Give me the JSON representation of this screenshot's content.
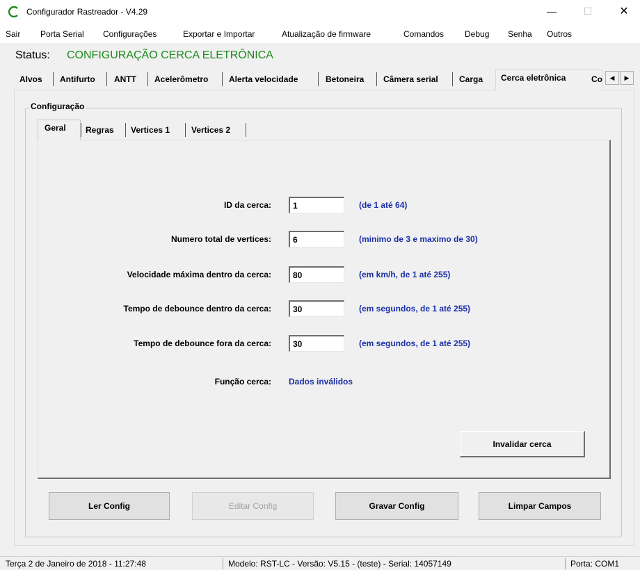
{
  "window": {
    "title": "Configurador Rastreador - V4.29",
    "controls": {
      "minimize": "—",
      "maximize": "☐",
      "close": "✕"
    }
  },
  "menu": [
    "Sair",
    "Porta Serial",
    "Configurações",
    "Exportar e Importar",
    "Atualização de firmware",
    "Comandos",
    "Debug",
    "Senha",
    "Outros"
  ],
  "status": {
    "label": "Status:",
    "value": "CONFIGURAÇÃO CERCA ELETRÔNICA"
  },
  "outer_tabs": [
    "Alvos",
    "Antifurto",
    "ANTT",
    "Acelerômetro",
    "Alerta velocidade",
    "Betoneira",
    "Câmera serial",
    "Carga",
    "Cerca eletrônica",
    "Co"
  ],
  "outer_tab_active": "Cerca eletrônica",
  "scroll_arrows": {
    "left": "◀",
    "right": "▶"
  },
  "group": {
    "title": "Configuração"
  },
  "inner_tabs": [
    "Geral",
    "Regras",
    "Vertices 1",
    "Vertices 2"
  ],
  "inner_tab_active": "Geral",
  "form": {
    "fields": [
      {
        "label": "ID da cerca:",
        "value": "1",
        "hint": "(de 1 até 64)"
      },
      {
        "label": "Numero total de vertices:",
        "value": "6",
        "hint": "(minimo de 3 e maximo de 30)"
      },
      {
        "label": "Velocidade máxima dentro da cerca:",
        "value": "80",
        "hint": "(em km/h, de 1 até 255)"
      },
      {
        "label": "Tempo de debounce dentro da cerca:",
        "value": "30",
        "hint": "(em segundos, de 1 até 255)"
      },
      {
        "label": "Tempo de debounce fora da cerca:",
        "value": "30",
        "hint": "(em segundos, de 1 até 255)"
      }
    ],
    "function_label": "Função cerca:",
    "function_value": "Dados inválidos",
    "invalidate_button": "Invalidar cerca"
  },
  "actions": {
    "read": "Ler Config",
    "edit": "Editar Config",
    "write": "Gravar Config",
    "clear": "Limpar Campos"
  },
  "statusbar": {
    "datetime": "Terça 2 de Janeiro de 2018  -  11:27:48",
    "device": "Modelo: RST-LC  -  Versão: V5.15 - (teste)  -  Serial: 14057149",
    "port": "Porta: COM1"
  },
  "colors": {
    "status_green": "#1b8a1b",
    "hint_blue": "#1b2fa8"
  }
}
